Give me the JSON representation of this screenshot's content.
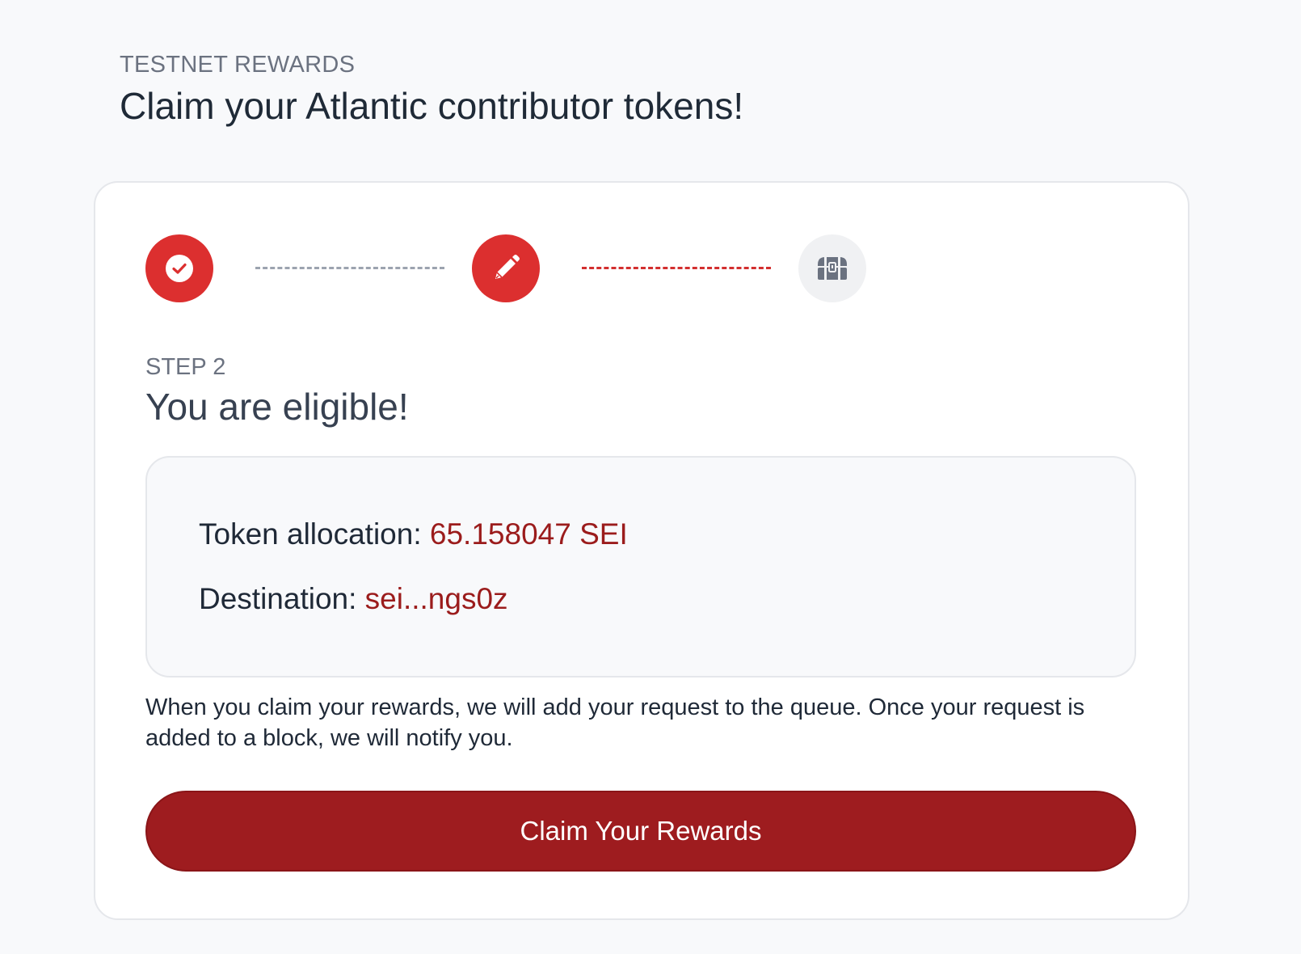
{
  "header": {
    "eyebrow": "TESTNET REWARDS",
    "title": "Claim your Atlantic contributor tokens!"
  },
  "stepper": {
    "steps": [
      {
        "status": "complete",
        "icon": "check-circle-icon"
      },
      {
        "status": "active",
        "icon": "pencil-icon"
      },
      {
        "status": "pending",
        "icon": "treasure-chest-icon"
      }
    ],
    "colors": {
      "active": "#dc2f2f",
      "pending_bg": "#f0f1f3",
      "pending_icon": "#6b7280",
      "connector_done": "#9ca3af",
      "connector_active": "#d32f2f"
    }
  },
  "step": {
    "label": "STEP 2",
    "heading": "You are eligible!"
  },
  "allocation": {
    "token_label": "Token allocation:",
    "token_value": "65.158047 SEI",
    "destination_label": "Destination:",
    "destination_value": "sei...ngs0z"
  },
  "note": "When you claim your rewards, we will add your request to the queue. Once your request is added to a block, we will notify you.",
  "actions": {
    "claim_label": "Claim Your Rewards",
    "claim_color": "#9e1c1f"
  }
}
